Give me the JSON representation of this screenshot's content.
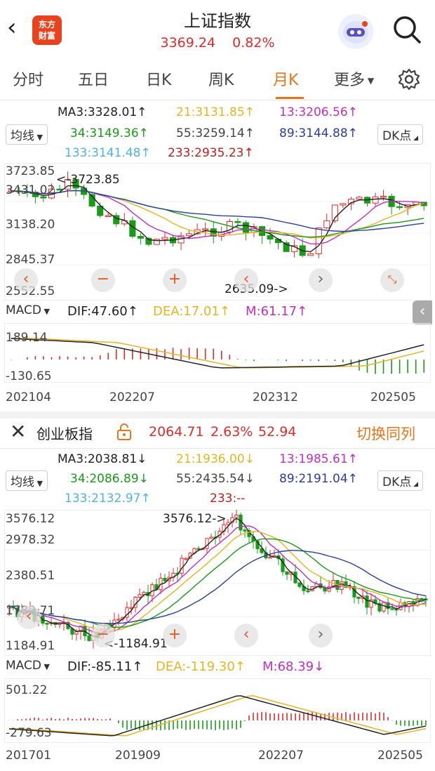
{
  "header": {
    "title": "上证指数",
    "price": "3369.24",
    "change_pct": "0.82%",
    "logo_line1": "东方",
    "logo_line2": "财富"
  },
  "tabs": [
    {
      "label": "分时"
    },
    {
      "label": "五日"
    },
    {
      "label": "日K"
    },
    {
      "label": "周K"
    },
    {
      "label": "月K"
    },
    {
      "label": "更多"
    }
  ],
  "panel1": {
    "indicator_select": "均线",
    "dk_select": "DK点",
    "ma": {
      "ma3": "MA3:3328.01↑",
      "ma21": "21:3131.85↑",
      "ma13": "13:3206.56↑",
      "ma34": "34:3149.36↑",
      "ma55": "55:3259.14↑",
      "ma89": "89:3144.88↑",
      "ma133": "133:3141.48↑",
      "ma233": "233:2935.23↑"
    },
    "y_ticks": [
      "3723.85",
      "3431.02",
      "3138.20",
      "2845.37",
      "2552.55"
    ],
    "high_label": "3723.85",
    "low_label": "2635.09->",
    "macd_select": "MACD",
    "dif": "DIF:47.60↑",
    "dea": "DEA:17.01↑",
    "m": "M:61.17↑",
    "macd_ticks": [
      "189.14",
      "-130.65"
    ],
    "dates": [
      "202104",
      "202207",
      "202312",
      "202505"
    ]
  },
  "panel2": {
    "name": "创业板指",
    "price": "2064.71",
    "change_pct": "2.63%",
    "change": "52.94",
    "switch_label": "切换同列",
    "indicator_select": "均线",
    "dk_select": "DK点",
    "ma": {
      "ma3": "MA3:2038.81↓",
      "ma21": "21:1936.00↓",
      "ma13": "13:1985.61↑",
      "ma34": "34:2086.89↓",
      "ma55": "55:2435.54↓",
      "ma89": "89:2191.04↑",
      "ma133": "133:2132.97↑",
      "ma233": "233:--"
    },
    "y_ticks": [
      "3576.12",
      "2978.32",
      "2380.51",
      "1782.71",
      "1184.91"
    ],
    "high_label": "3576.12->",
    "low_label": "<-1184.91",
    "macd_select": "MACD",
    "dif": "DIF:-85.11↑",
    "dea": "DEA:-119.30↑",
    "m": "M:68.39↓",
    "macd_ticks": [
      "501.22",
      "-279.63"
    ],
    "dates": [
      "201701",
      "201909",
      "202207",
      "202505"
    ]
  },
  "colors": {
    "red": "#e02b2b",
    "green": "#1a9a1a",
    "orange": "#e8751a",
    "ma21": "#e6b422",
    "ma13": "#c22ec2",
    "ma89": "#2a3f9e",
    "ma133": "#4fb3e8"
  }
}
